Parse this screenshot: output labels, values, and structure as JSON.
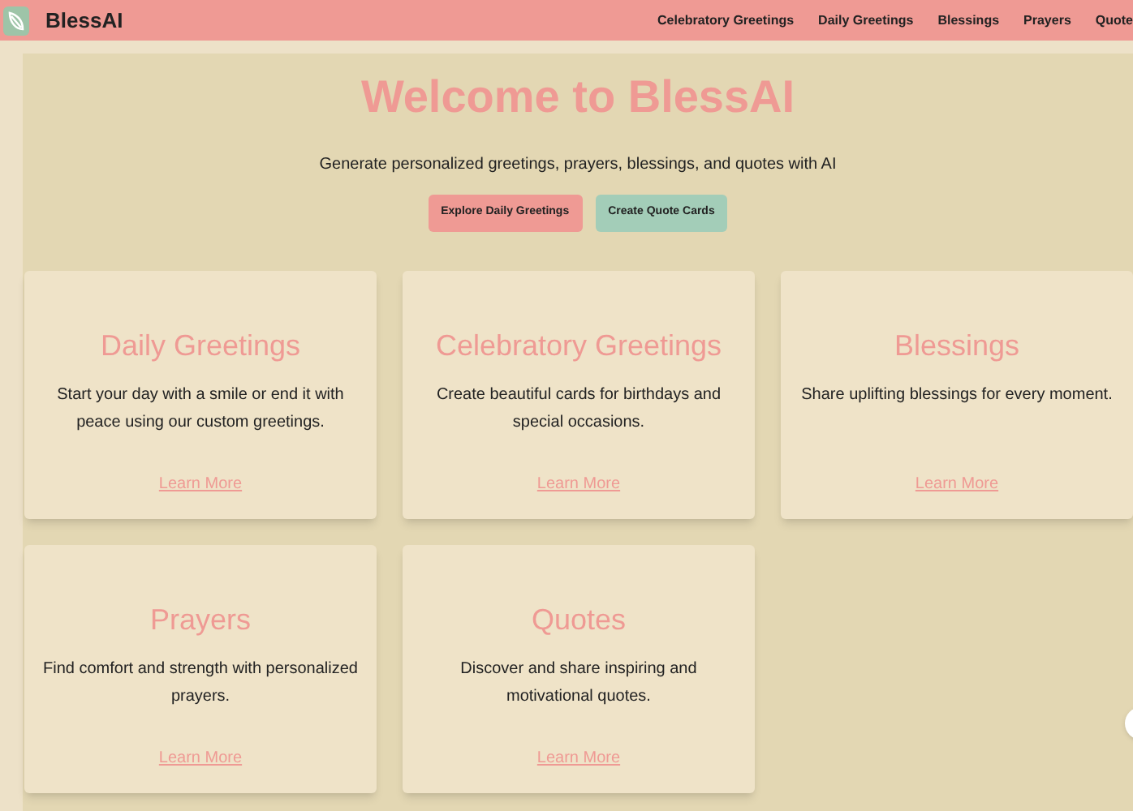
{
  "header": {
    "brand": "BlessAI",
    "nav": [
      "Celebratory Greetings",
      "Daily Greetings",
      "Blessings",
      "Prayers",
      "Quote"
    ]
  },
  "hero": {
    "title": "Welcome to BlessAI",
    "subtitle": "Generate personalized greetings, prayers, blessings, and quotes with AI",
    "buttons": [
      {
        "label": "Explore Daily Greetings",
        "kind": "primary"
      },
      {
        "label": "Create Quote Cards",
        "kind": "secondary"
      }
    ]
  },
  "cards": [
    {
      "title": "Daily Greetings",
      "text": "Start your day with a smile or end it with peace using our custom greetings.",
      "link": "Learn More"
    },
    {
      "title": "Celebratory Greetings",
      "text": "Create beautiful cards for birthdays and special occasions.",
      "link": "Learn More"
    },
    {
      "title": "Blessings",
      "text": "Share uplifting blessings for every moment.",
      "link": "Learn More"
    },
    {
      "title": "Prayers",
      "text": "Find comfort and strength with personalized prayers.",
      "link": "Learn More"
    },
    {
      "title": "Quotes",
      "text": "Discover and share inspiring and motivational quotes.",
      "link": "Learn More"
    }
  ]
}
